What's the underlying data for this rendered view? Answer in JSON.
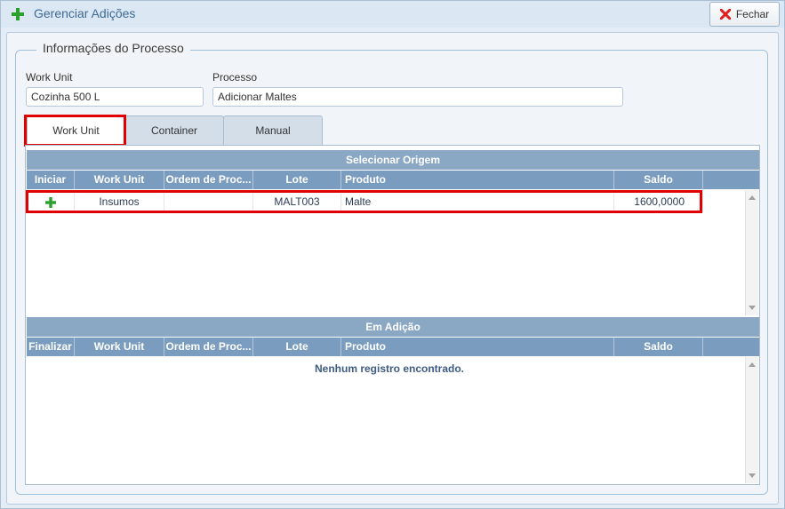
{
  "window": {
    "title": "Gerenciar Adições",
    "close_label": "Fechar",
    "colors": {
      "accent": "#3d6a96",
      "header": "#8aa7c4",
      "column_header": "#7a9cbf",
      "highlight": "#e00000",
      "add_icon": "#2ca02c"
    }
  },
  "process_info": {
    "legend": "Informações do Processo",
    "work_unit_label": "Work Unit",
    "work_unit_value": "Cozinha 500 L",
    "process_label": "Processo",
    "process_value": "Adicionar Maltes"
  },
  "tabs": [
    {
      "label": "Work Unit",
      "active": true
    },
    {
      "label": "Container",
      "active": false
    },
    {
      "label": "Manual",
      "active": false
    }
  ],
  "origin_grid": {
    "title": "Selecionar Origem",
    "columns": [
      "Iniciar",
      "Work Unit",
      "Ordem de Proc...",
      "Lote",
      "Produto",
      "Saldo"
    ],
    "rows": [
      {
        "action_icon": "plus-icon",
        "work_unit": "Insumos",
        "ordem": "",
        "lote": "MALT003",
        "produto": "Malte",
        "saldo": "1600,0000"
      }
    ]
  },
  "adding_grid": {
    "title": "Em Adição",
    "columns": [
      "Finalizar",
      "Work Unit",
      "Ordem de Proc...",
      "Lote",
      "Produto",
      "Saldo"
    ],
    "empty_message": "Nenhum registro encontrado."
  }
}
